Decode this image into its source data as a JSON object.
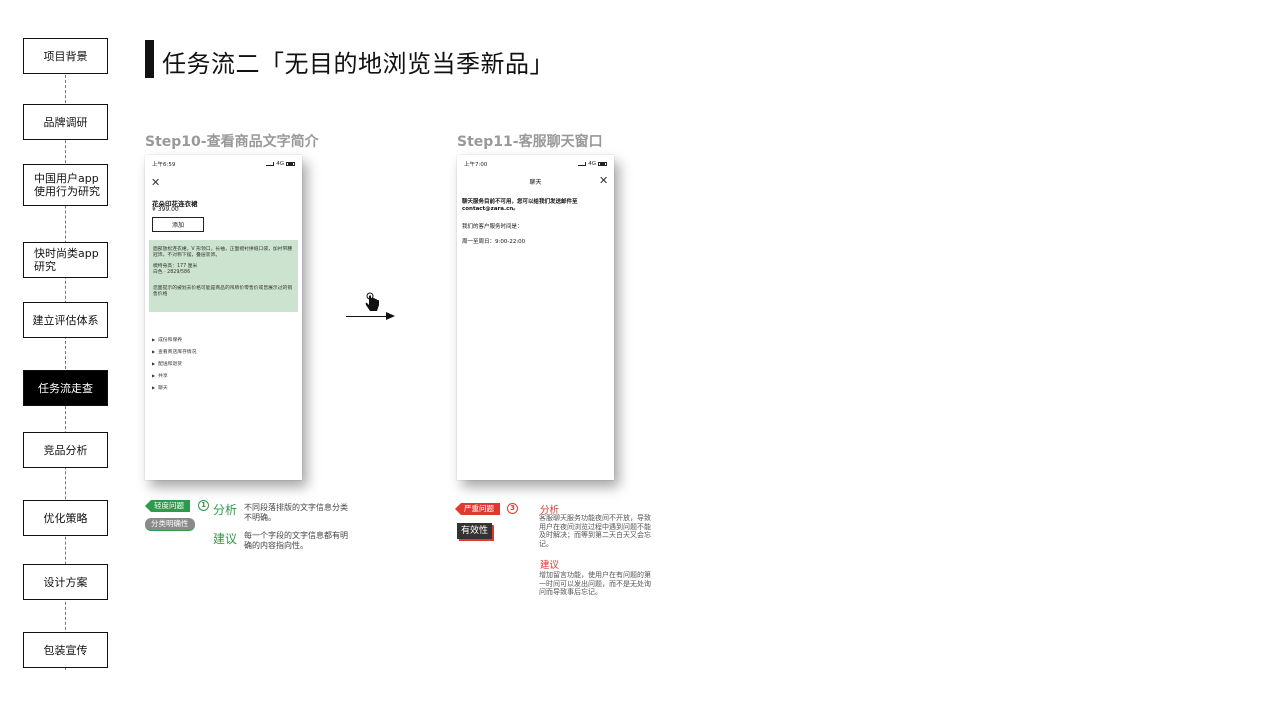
{
  "nav": {
    "items": [
      {
        "label": "项目背景",
        "active": false
      },
      {
        "label": "品牌调研",
        "active": false
      },
      {
        "label": "中国用户app\n使用行为研究",
        "active": false
      },
      {
        "label": "快时尚类app\n研究",
        "active": false
      },
      {
        "label": "建立评估体系",
        "active": false
      },
      {
        "label": "任务流走查",
        "active": true
      },
      {
        "label": "竞品分析",
        "active": false
      },
      {
        "label": "优化策略",
        "active": false
      },
      {
        "label": "设计方案",
        "active": false
      },
      {
        "label": "包装宣传",
        "active": false
      }
    ]
  },
  "page": {
    "title": "任务流二「无目的地浏览当季新品」"
  },
  "step10": {
    "title": "Step10-查看商品文字简介",
    "phone": {
      "time": "上午6:59",
      "network": "4G",
      "product_name": "花朵印花连衣裙",
      "price": "¥ 399.00",
      "add_button": "添加",
      "description": "面部放松连衣裙，V 形领口，长袖，正面褶衬拼缝口袋，加衬带腰冠饰，不对称下摆，叠层装饰。",
      "model_info": "模特身高：177 厘米",
      "color_info": "白色 · 2829/586",
      "price_note": "您面提示的被划去价格可能是商品的吊牌价零售价或曾展示过的销售价格",
      "menu": [
        "成份和保养",
        "查看商店库存情况",
        "配送和退货",
        "共享",
        "聊天"
      ]
    },
    "tag_level": "轻度问题",
    "tag_level_num": "1",
    "tag_category": "分类明确性",
    "analysis_label": "分析",
    "analysis_text": "不同段落排版的文字信息分类不明确。",
    "suggestion_label": "建议",
    "suggestion_text": "每一个字段的文字信息都有明确的内容指向性。"
  },
  "step11": {
    "title": "Step11-客服聊天窗口",
    "phone": {
      "time": "上午7:00",
      "network": "4G",
      "header": "聊天",
      "message": "聊天服务目前不可用，您可以给我们发送邮件至 contact@zara.cn。",
      "hours_label": "我们的客户服务时间是：",
      "hours": "周一至周日：9:00-22:00"
    },
    "tag_level": "严重问题",
    "tag_level_num": "3",
    "tag_category": "有效性",
    "analysis_label": "分析",
    "analysis_text": "客服聊天服务功能夜间不开放，导致用户在夜间浏览过程中遇到问题不能及时解决；而等到第二天白天又会忘记。",
    "suggestion_label": "建议",
    "suggestion_text": "增加留言功能，使用户在有问题的第一时间可以发出问题，而不是无处询问而导致事后忘记。"
  },
  "icons": {
    "close": "close-icon",
    "transition": "tap-hand-icon",
    "arrow": "arrow-right-icon"
  },
  "colors": {
    "minor": "#2e9a4b",
    "severe": "#e0392f",
    "active_nav": "#000000",
    "highlight": "#cce4cf"
  }
}
